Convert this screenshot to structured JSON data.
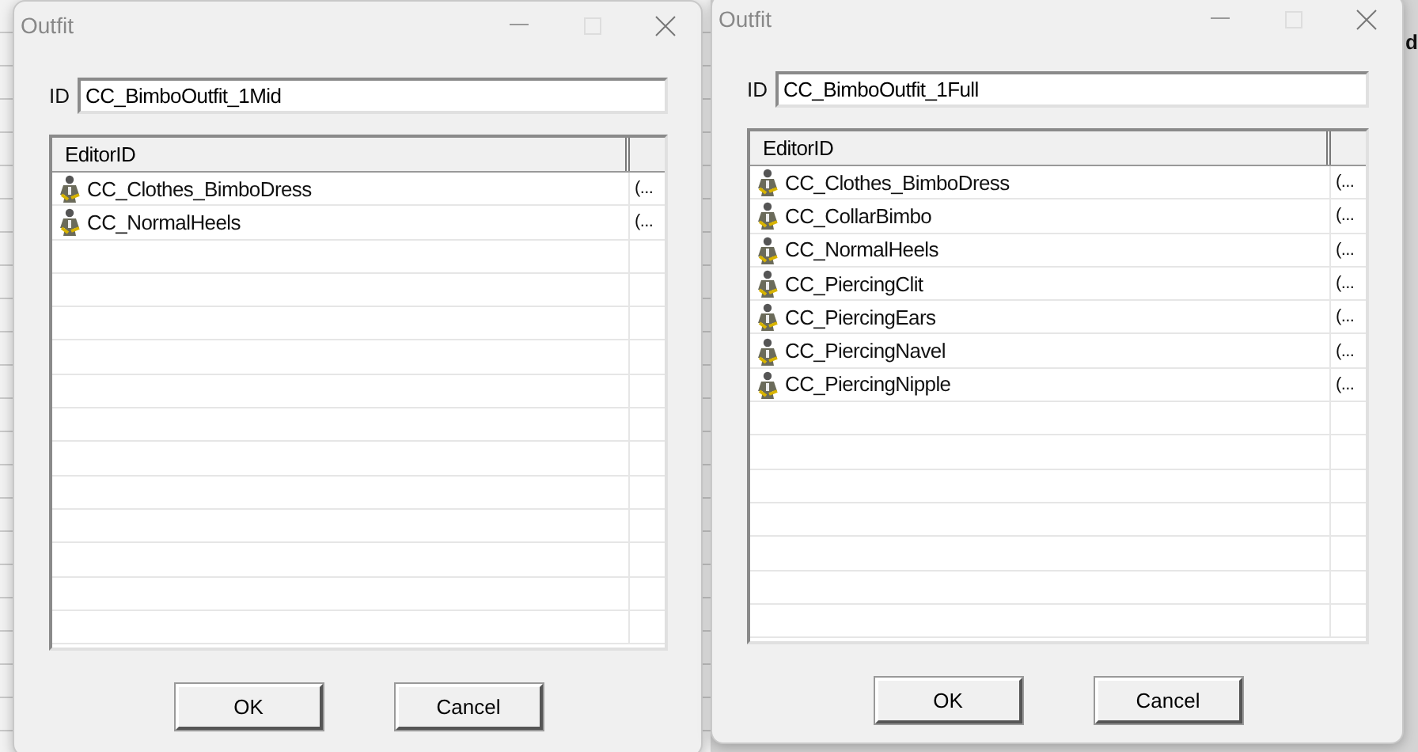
{
  "background_text": "d",
  "dialogs": [
    {
      "title": "Outfit",
      "id_label": "ID",
      "id_value": "CC_BimboOutfit_1Mid",
      "columns": [
        "EditorID"
      ],
      "rows": [
        {
          "editor_id": "CC_Clothes_BimboDress",
          "column_2": "(..."
        },
        {
          "editor_id": "CC_NormalHeels",
          "column_2": "(..."
        }
      ],
      "buttons": [
        "OK",
        "Cancel"
      ]
    },
    {
      "title": "Outfit",
      "id_label": "ID",
      "id_value": "CC_BimboOutfit_1Full",
      "columns": [
        "EditorID"
      ],
      "rows": [
        {
          "editor_id": "CC_Clothes_BimboDress",
          "column_2": "(..."
        },
        {
          "editor_id": "CC_CollarBimbo",
          "column_2": "(..."
        },
        {
          "editor_id": "CC_NormalHeels",
          "column_2": "(..."
        },
        {
          "editor_id": "CC_PiercingClit",
          "column_2": "(..."
        },
        {
          "editor_id": "CC_PiercingEars",
          "column_2": "(..."
        },
        {
          "editor_id": "CC_PiercingNavel",
          "column_2": "(..."
        },
        {
          "editor_id": "CC_PiercingNipple",
          "column_2": "(..."
        }
      ],
      "buttons": [
        "OK",
        "Cancel"
      ]
    }
  ]
}
